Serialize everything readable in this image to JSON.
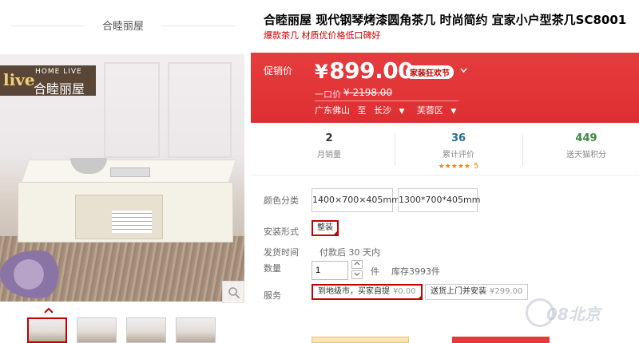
{
  "shop": {
    "name": "合睦丽屋"
  },
  "gallery": {
    "logo": {
      "live": "live",
      "home_live": "HOME LIVE",
      "name_cn": "合睦丽屋"
    },
    "zoom_icon": "magnifier-icon",
    "thumb_count": 5,
    "active_thumb": 0
  },
  "product": {
    "title": "合睦丽屋 现代钢琴烤漆圆角茶几 时尚简约 宜家小户型茶几SC8001",
    "subtitle": "爆款茶几 材质优价格低口碑好"
  },
  "promo": {
    "label": "促销价",
    "currency": "¥",
    "price": "899.00",
    "badge": "家装狂欢节",
    "original_label": "一口价",
    "original_price": "¥ 2198.00",
    "ship_from": "广东佛山",
    "ship_to_word": "至",
    "ship_city": "长沙",
    "ship_district": "芙蓉区",
    "accent_color": "#e4393c"
  },
  "stats": {
    "monthly_sales": {
      "value": "2",
      "label": "月销量"
    },
    "reviews": {
      "value": "36",
      "label": "累计评价",
      "stars": "★★★★★",
      "rating": "5"
    },
    "points": {
      "value": "449",
      "label": "送天猫积分"
    }
  },
  "options": {
    "color_label": "颜色分类",
    "colors": [
      "1400×700×405mm",
      "1300*700*405mm"
    ],
    "install_label": "安装形式",
    "install_value": "整装",
    "ship_label": "发货时间",
    "ship_text": "付款后 30 天内",
    "qty_label": "数量",
    "qty_value": "1",
    "qty_unit": "件",
    "stock": "库存3993件",
    "service_label": "服务",
    "services": [
      {
        "name": "到地级市，买家自提",
        "fee": "¥0.00"
      },
      {
        "name": "送货上门并安装",
        "fee": "¥299.00"
      }
    ]
  },
  "watermark": "08北京"
}
